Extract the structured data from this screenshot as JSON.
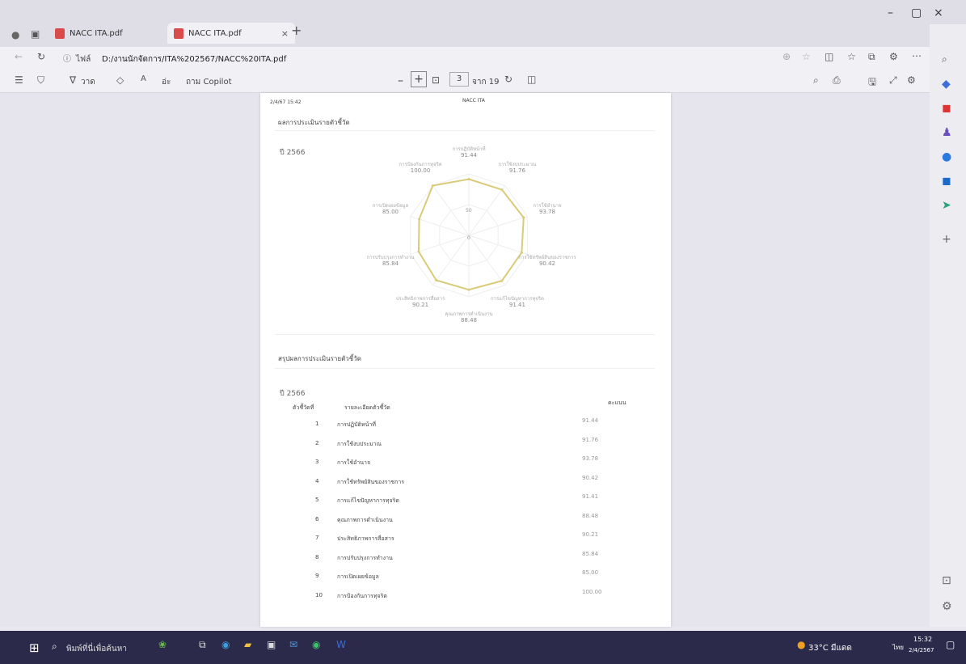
{
  "browser": {
    "tabs": [
      {
        "label": "NACC ITA.pdf"
      },
      {
        "label": "NACC ITA.pdf"
      }
    ],
    "new_tab": "+",
    "address_security": "ไฟล์",
    "address_url": "D:/งานนักจัดการ/ITA%202567/NACC%20ITA.pdf"
  },
  "pdf_toolbar": {
    "draw": "วาด",
    "read_aloud": "อ่ะ",
    "ask_copilot": "ถาม Copilot",
    "page_current": "3",
    "page_total": "จาก 19",
    "minus": "–",
    "plus": "+"
  },
  "page": {
    "header_left": "2/4/67 15:42",
    "header_center": "NACC ITA",
    "section1_title": "ผลการประเมินรายตัวชี้วัด",
    "year1": "ปี 2566",
    "radar_scale": [
      "50",
      "0"
    ],
    "section2_title": "สรุปผลการประเมินรายตัวชี้วัด",
    "year2": "ปี 2566",
    "table": {
      "headers": [
        "ตัวชี้วัดที่",
        "รายละเอียดตัวชี้วัด",
        "คะแนน"
      ],
      "rows": [
        {
          "num": "1",
          "label": "การปฏิบัติหน้าที่",
          "score": "91.44"
        },
        {
          "num": "2",
          "label": "การใช้งบประมาณ",
          "score": "91.76"
        },
        {
          "num": "3",
          "label": "การใช้อำนาจ",
          "score": "93.78"
        },
        {
          "num": "4",
          "label": "การใช้ทรัพย์สินของราชการ",
          "score": "90.42"
        },
        {
          "num": "5",
          "label": "การแก้ไขปัญหาการทุจริต",
          "score": "91.41"
        },
        {
          "num": "6",
          "label": "คุณภาพการดำเนินงาน",
          "score": "88.48"
        },
        {
          "num": "7",
          "label": "ประสิทธิภาพการสื่อสาร",
          "score": "90.21"
        },
        {
          "num": "8",
          "label": "การปรับปรุงการทำงาน",
          "score": "85.84"
        },
        {
          "num": "9",
          "label": "การเปิดเผยข้อมูล",
          "score": "85.00"
        },
        {
          "num": "10",
          "label": "การป้องกันการทุจริต",
          "score": "100.00"
        }
      ]
    }
  },
  "chart_data": {
    "type": "radar",
    "categories": [
      "การปฏิบัติหน้าที่",
      "การใช้งบประมาณ",
      "การใช้อำนาจ",
      "การใช้ทรัพย์สินของราชการ",
      "การแก้ไขปัญหาการทุจริต",
      "คุณภาพการดำเนินงาน",
      "ประสิทธิภาพการสื่อสาร",
      "การปรับปรุงการทำงาน",
      "การเปิดเผยข้อมูล",
      "การป้องกันการทุจริต"
    ],
    "values": [
      91.44,
      91.76,
      93.78,
      90.42,
      91.41,
      88.48,
      90.21,
      85.84,
      85.0,
      100.0
    ],
    "labels": [
      "91.44",
      "91.76",
      "93.78",
      "90.42",
      "91.41",
      "88.48",
      "90.21",
      "85.84",
      "85.00",
      "100.00"
    ],
    "rlim": [
      0,
      100
    ],
    "color": "#d9cb7a"
  },
  "taskbar": {
    "search_placeholder": "พิมพ์ที่นี่เพื่อค้นหา",
    "weather": "33°C มีแดด",
    "language": "ไทย",
    "time": "15:32",
    "date": "2/4/2567"
  }
}
